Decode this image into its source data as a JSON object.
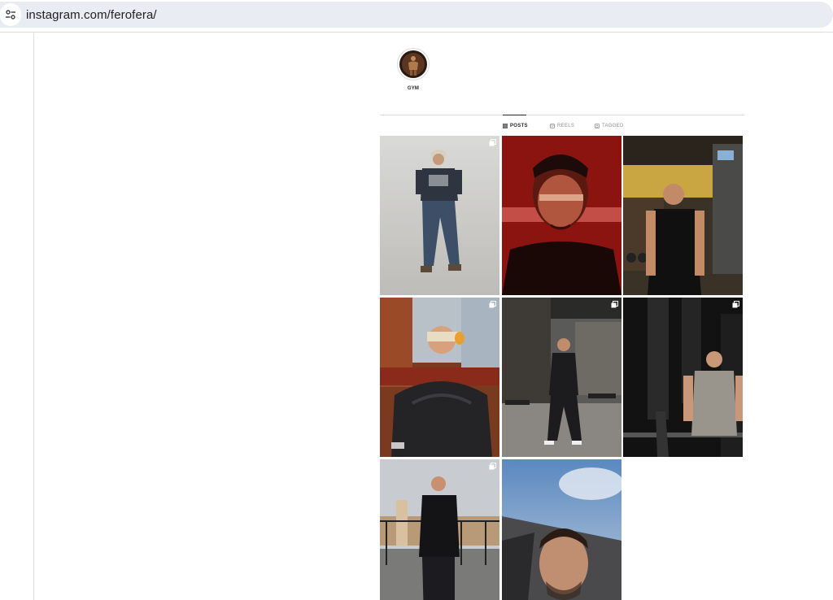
{
  "browser": {
    "url": "instagram.com/ferofera/",
    "site_settings_icon": "tune-icon"
  },
  "highlight": {
    "label": "GYM"
  },
  "tabs": [
    {
      "label": "POSTS",
      "icon": "grid-icon",
      "active": true
    },
    {
      "label": "REELS",
      "icon": "reels-icon",
      "active": false
    },
    {
      "label": "TAGGED",
      "icon": "tagged-icon",
      "active": false
    }
  ],
  "posts": [
    {
      "subject": "studio portrait, bucket hat, patterned shirt, jeans",
      "multiple": true
    },
    {
      "subject": "red-lit face close-up",
      "multiple": false
    },
    {
      "subject": "gym, black tank top",
      "multiple": false
    },
    {
      "subject": "winter jacket, goggles on head",
      "multiple": true
    },
    {
      "subject": "cafe terrace, dark tracksuit",
      "multiple": true
    },
    {
      "subject": "gym, grey t-shirt",
      "multiple": true
    },
    {
      "subject": "rooftop, black jacket",
      "multiple": true
    },
    {
      "subject": "car selfie, sky",
      "multiple": false
    }
  ],
  "colors": {
    "accent_text": "#262626",
    "muted_text": "#8e8e8e",
    "divider": "#dbdbdb",
    "address_bar": "#e9ecf2"
  }
}
